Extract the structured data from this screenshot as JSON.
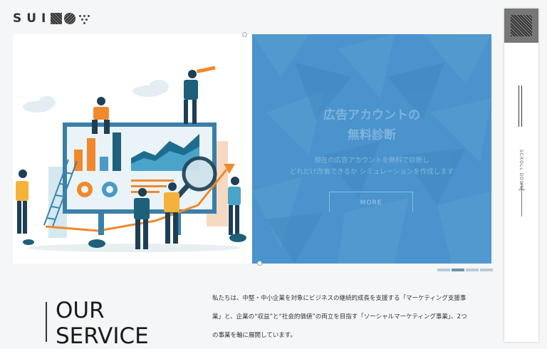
{
  "logo": {
    "text": "SUI",
    "marks": [
      "square-mark-icon",
      "circle-mark-icon",
      "triangle-dots-icon"
    ]
  },
  "hero": {
    "title_line1": "広告アカウントの",
    "title_line2": "無料診断",
    "desc_line1": "現在の広告アカウントを無料で診断し",
    "desc_line2": "どれだけ改善できるか シミュレーションを作成します",
    "more_label": "MORE"
  },
  "pager": {
    "count": 4,
    "active_index": 1
  },
  "side": {
    "scroll_label": "SCROLL DOWN"
  },
  "service": {
    "title_line1": "OUR",
    "title_line2": "SERVICE",
    "text": "私たちは、中堅・中小企業を対象にビジネスの継続的成長を支援する「マーケティング支援事業」と、企業の“収益”と“社会的価値”の両立を目指す「ソーシャルマーケティング事業」、2つの事業を軸に展開しています。"
  },
  "colors": {
    "accent_blue": "#4a93cc",
    "orange": "#f0892b",
    "teal": "#1e5f7a",
    "background": "#f4f6f7"
  }
}
